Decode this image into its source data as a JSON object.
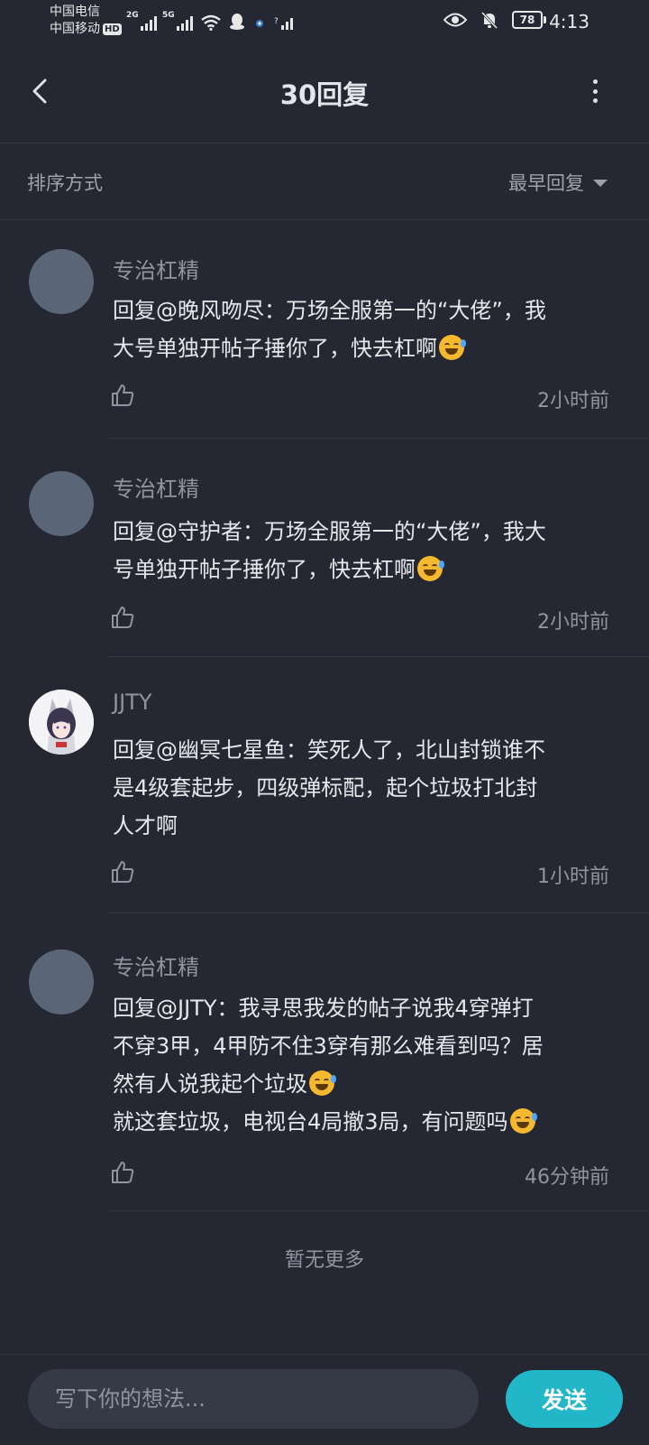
{
  "status_bar": {
    "carrier1": "中国电信",
    "carrier2": "中国移动",
    "hd": "HD",
    "net1": "2G",
    "net2": "5G",
    "battery": "78",
    "time": "4:13"
  },
  "header": {
    "title": "30回复"
  },
  "sort": {
    "label": "排序方式",
    "value": "最早回复"
  },
  "comments": [
    {
      "user": "专治杠精",
      "lines": [
        "回复@晚风吻尽：万场全服第一的“大佬”，我",
        "大号单独开帖子捶你了，快去杠啊"
      ],
      "emoji_after_line": 1,
      "emoji_name": "rofl-emoji",
      "time": "2小时前"
    },
    {
      "user": "专治杠精",
      "lines": [
        "回复@守护者：万场全服第一的“大佬”，我大",
        "号单独开帖子捶你了，快去杠啊"
      ],
      "emoji_after_line": 1,
      "emoji_name": "rofl-emoji",
      "time": "2小时前"
    },
    {
      "user": "JJTY",
      "lines": [
        "回复@幽冥七星鱼：笑死人了，北山封锁谁不",
        "是4级套起步，四级弹标配，起个垃圾打北封",
        "人才啊"
      ],
      "time": "1小时前"
    },
    {
      "user": "专治杠精",
      "lines": [
        "回复@JJTY：我寻思我发的帖子说我4穿弹打",
        "不穿3甲，4甲防不住3穿有那么难看到吗？居",
        "然有人说我起个垃圾",
        "就这套垃圾，电视台4局撤3局，有问题吗"
      ],
      "time": "46分钟前"
    }
  ],
  "footer": {
    "no_more": "暂无更多",
    "input_placeholder": "写下你的想法...",
    "send": "发送"
  }
}
